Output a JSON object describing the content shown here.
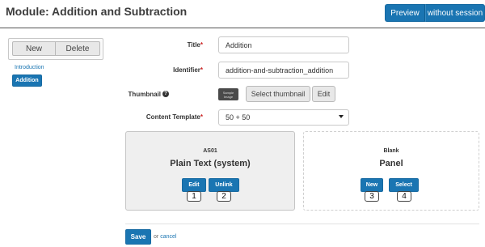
{
  "header": {
    "title": "Module: Addition and Subtraction",
    "preview_label": "Preview",
    "without_session_label": "without session"
  },
  "sidebar": {
    "new_label": "New",
    "delete_label": "Delete",
    "intro_link": "Introduction",
    "active_item": "Addition"
  },
  "form": {
    "title_label": "Title",
    "title_value": "Addition",
    "identifier_label": "Identifier",
    "identifier_value": "addition-and-subtraction_addition",
    "thumbnail_label": "Thumbnail",
    "thumbnail_image_line1": "Sample",
    "thumbnail_image_line2": "Image",
    "select_thumbnail_label": "Select thumbnail",
    "edit_label": "Edit",
    "content_template_label": "Content Template",
    "content_template_value": "50 + 50",
    "required_mark": "*"
  },
  "panels": {
    "left": {
      "code": "AS01",
      "title": "Plain Text (system)",
      "edit_label": "Edit",
      "unlink_label": "Unlink",
      "markers": [
        "1",
        "2"
      ]
    },
    "right": {
      "code": "Blank",
      "title": "Panel",
      "new_label": "New",
      "select_label": "Select",
      "markers": [
        "3",
        "4"
      ]
    }
  },
  "footer": {
    "save_label": "Save",
    "or_text": "or",
    "cancel_label": "cancel"
  },
  "colors": {
    "primary": "#1a75b2",
    "required": "#cc2222"
  }
}
